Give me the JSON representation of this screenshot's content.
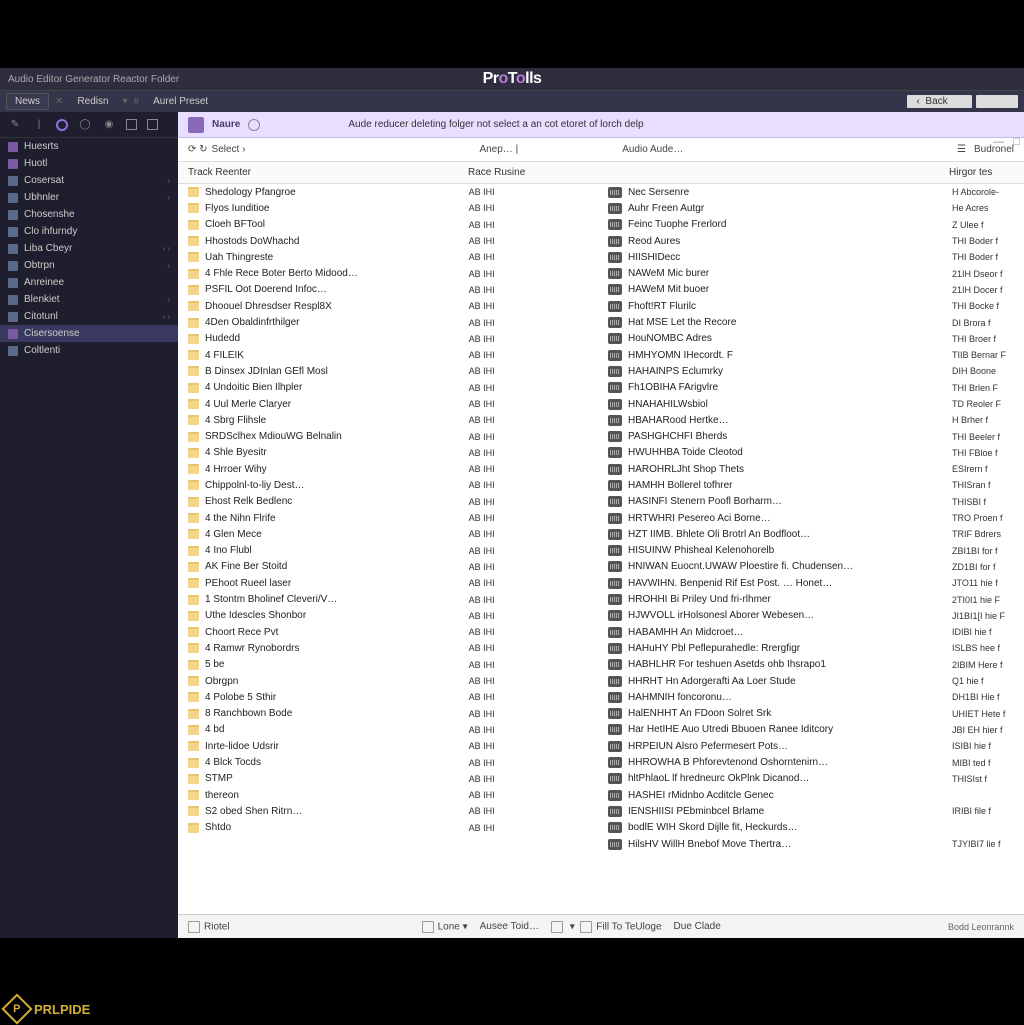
{
  "app_title": "ProTools",
  "titlebar_text": "Audio Editor Generator Reactor Folder",
  "toolbar": {
    "items": [
      "News",
      "Redisn",
      "Aurel Preset"
    ],
    "search_label": "Back"
  },
  "notice": {
    "label": "Naure",
    "text": "Aude reducer deleting folger not select a an cot etoret of lorch delp"
  },
  "crumbs": {
    "path": "Select ›",
    "mid": "Anep… |",
    "audio": "Audio Aude…",
    "browse": "Budronel"
  },
  "headers": {
    "name": "Track Reenter",
    "kind": "Race Rusine",
    "audio": "",
    "size": "Hirgor tes"
  },
  "sidebar": {
    "items": [
      {
        "label": "Huesrts",
        "chev": ""
      },
      {
        "label": "Huotl",
        "chev": ""
      },
      {
        "label": "Cosersat",
        "chev": "›"
      },
      {
        "label": "Ubhnler",
        "chev": "›"
      },
      {
        "label": "Chosenshe",
        "chev": ""
      },
      {
        "label": "Clo ihfurndy",
        "chev": ""
      },
      {
        "label": "Liba Cbeyr",
        "chev": "› ›"
      },
      {
        "label": "Obtrpn",
        "chev": "›"
      },
      {
        "label": "Anreinee",
        "chev": ""
      },
      {
        "label": "Blenkiet",
        "chev": "›"
      },
      {
        "label": "Citotunl",
        "chev": "› ›"
      },
      {
        "label": "Cisersoense",
        "chev": "",
        "selected": true
      },
      {
        "label": "Coltlenti",
        "chev": ""
      }
    ]
  },
  "folders": [
    {
      "name": "Shedology Pfangroe",
      "kind": "AB IHI"
    },
    {
      "name": "Flyos Iunditioe",
      "kind": "AB IHI"
    },
    {
      "name": "Cloeh BFTool",
      "kind": "AB IHI"
    },
    {
      "name": "Hhostods DoWhachd",
      "kind": "AB IHI"
    },
    {
      "name": "Uah Thingreste",
      "kind": "AB IHI"
    },
    {
      "name": "4 Fhle Rece Boter Berto Midood…",
      "kind": "AB IHI"
    },
    {
      "name": "PSFIL Oot Doerend Infoc…",
      "kind": "AB IHI"
    },
    {
      "name": "Dhoouel Dhresdser Respl8X",
      "kind": "AB IHI"
    },
    {
      "name": "4Den Obaldinfrthilger",
      "kind": "AB IHI"
    },
    {
      "name": "Hudedd",
      "kind": "AB IHI"
    },
    {
      "name": "4 FILEIK",
      "kind": "AB IHI"
    },
    {
      "name": "B Dinsex JDInlan GEfl Mosl",
      "kind": "AB IHI"
    },
    {
      "name": "4 Undoitic Bien Ilhpler",
      "kind": "AB IHI"
    },
    {
      "name": "4 Uul Merle Claryer",
      "kind": "AB IHI"
    },
    {
      "name": "4 Sbrg Flihsle",
      "kind": "AB IHI"
    },
    {
      "name": "SRDSclhex MdiouWG Belnalin",
      "kind": "AB IHI"
    },
    {
      "name": "4 Shle Byesitr",
      "kind": "AB IHI"
    },
    {
      "name": "4 Hrroer Wihy",
      "kind": "AB IHI"
    },
    {
      "name": "Chippolnl-to-liy Dest…",
      "kind": "AB IHI"
    },
    {
      "name": "Ehost Relk Bedlenc",
      "kind": "AB IHI"
    },
    {
      "name": "4 the Nihn Flrife",
      "kind": "AB IHI"
    },
    {
      "name": "4 Glen Mece",
      "kind": "AB IHI"
    },
    {
      "name": "4 Ino Flubl",
      "kind": "AB IHI"
    },
    {
      "name": "AK Fine Ber Stoitd",
      "kind": "AB IHI"
    },
    {
      "name": "PEhoot Rueel laser",
      "kind": "AB IHI"
    },
    {
      "name": "1 Stontm Bholinef Cleveri/V…",
      "kind": "AB IHI"
    },
    {
      "name": "Uthe Idescles Shonbor",
      "kind": "AB IHI"
    },
    {
      "name": "Choort Rece Pvt",
      "kind": "AB IHI"
    },
    {
      "name": "4 Ramwr Rynobordrs",
      "kind": "AB IHI"
    },
    {
      "name": "5 be",
      "kind": "AB IHI"
    },
    {
      "name": "Obrgpn",
      "kind": "AB IHI"
    },
    {
      "name": "4 Polobe 5 Sthir",
      "kind": "AB IHI"
    },
    {
      "name": "8 Ranchbown Bode",
      "kind": "AB IHI"
    },
    {
      "name": "4 bd",
      "kind": "AB IHI"
    },
    {
      "name": "Inrte-lidoe Udsrir",
      "kind": "AB IHI"
    },
    {
      "name": "4 Blck Tocds",
      "kind": "AB IHI"
    },
    {
      "name": "STMP",
      "kind": "AB IHI"
    },
    {
      "name": "thereon",
      "kind": "AB IHI"
    },
    {
      "name": "S2 obed Shen Ritrn…",
      "kind": "AB IHI"
    },
    {
      "name": "Shtdo",
      "kind": "AB IHI"
    }
  ],
  "audio": [
    {
      "name": "Nec Sersenre",
      "size": "H Abcorole-"
    },
    {
      "name": "Auhr Freen Autgr",
      "size": "He Acres"
    },
    {
      "name": "Feinc Tuophe Frerlord",
      "size": "Z Ulee f"
    },
    {
      "name": "Reod Aures",
      "size": "THI Boder f"
    },
    {
      "name": "HIISHIDecc",
      "size": "THI Boder f"
    },
    {
      "name": "NAWeM Mic burer",
      "size": "21IH Dseor f"
    },
    {
      "name": "HAWeM Mit buoer",
      "size": "21IH Docer f"
    },
    {
      "name": "Fhoft!RT Flurilc",
      "size": "THI Bocke f"
    },
    {
      "name": "Hat MSE Let the Recore",
      "size": "DI Brora f"
    },
    {
      "name": "HouNOMBC Adres",
      "size": "THI Broer f"
    },
    {
      "name": "HMHYOMN IHecordt. F",
      "size": "TIIB Bernar F"
    },
    {
      "name": "HAHAINPS Eclumrky",
      "size": "DIH Boone"
    },
    {
      "name": "Fh1OBIHA FArigvlre",
      "size": "THI Brlen F"
    },
    {
      "name": "HNAHAHILWsbiol",
      "size": "TD Reoler F"
    },
    {
      "name": "HBAHARood Hertke…",
      "size": "H Brher f"
    },
    {
      "name": "PASHGHCHFI Bherds",
      "size": "THI Beeler f"
    },
    {
      "name": "HWUHHBA Toide Cleotod",
      "size": "THI FBloe f"
    },
    {
      "name": "HAROHRLJht Shop Thets",
      "size": "ESIrern f"
    },
    {
      "name": "HAMHH Bollerel tofhrer",
      "size": "THISran f"
    },
    {
      "name": "HASINFI Stenern Poofl Borharm…",
      "size": "THISBI f"
    },
    {
      "name": "HRTWHRI Pesereo Aci Borne…",
      "size": "TRO Proen f"
    },
    {
      "name": "HZT IIMB. Bhlete Oli Brotrl An Bodfloot…",
      "size": "TRIF Bdrers"
    },
    {
      "name": "HISUINW Phisheal Kelenohorelb",
      "size": "ZBI1BI for f"
    },
    {
      "name": "HNIWAN Euocnt.UWAW Ploestire fi. Chudensen…",
      "size": "ZD1BI for f"
    },
    {
      "name": "HAVWIHN. Benpenid Rif Est Post. … Honet…",
      "size": "JTO11 hie f"
    },
    {
      "name": "HROHHI Bi Priley Und fri-rlhmer",
      "size": "2TI0I1 hie F"
    },
    {
      "name": "HJWVOLL irHolsonesl Aborer Webesen…",
      "size": "JI1BI1[I hie F"
    },
    {
      "name": "HABAMHH An Midcroet…",
      "size": "IDIBI hie f"
    },
    {
      "name": "HAHuHY Pbl Peflepurahedle: Rrergfigr",
      "size": "ISLBS hee f"
    },
    {
      "name": "HABHLHR For teshuen Asetds ohb Ihsrapo1",
      "size": "2IBIM Here f"
    },
    {
      "name": "HHRHT Hn Adorgerafti Aa Loer Stude",
      "size": "Q1 hie f"
    },
    {
      "name": "HAHMNIH foncoronu…",
      "size": "DH1BI Hie f"
    },
    {
      "name": "HalENHHT An FDoon Solret Srk",
      "size": "UHIET Hete f"
    },
    {
      "name": "Har HetIHE Auo Utredi Bbuoen Ranee Iditcory",
      "size": "JBI EH hier f"
    },
    {
      "name": "HRPEIUN Alsro Pefermesert Pots…",
      "size": "ISIBI hie f"
    },
    {
      "name": "HHROWHA B Phforevtenond Oshorntenirn…",
      "size": "MIBI ted f"
    },
    {
      "name": "hltPhlaoL lf hredneurc OkPlnk Dicanod…",
      "size": "THISIst f"
    },
    {
      "name": "HASHEI rMidnbo Acditcle Genec",
      "size": ""
    },
    {
      "name": "IENSHIISI PEbminbcel Brlame",
      "size": "IRIBI file f"
    },
    {
      "name": "bodlE WIH Skord Dijlle fit, Heckurds…",
      "size": ""
    },
    {
      "name": "HilsHV WillH Bnebof Move Thertra…",
      "size": "TJYIBI7 lie f"
    }
  ],
  "statusbar": {
    "items": [
      "Riotel",
      "Lone",
      "Ausee Toid…",
      "Fill To TeUloge",
      "Due Clade"
    ],
    "right": "Bodd Leonrannk"
  },
  "brand": "PRLPIDE"
}
